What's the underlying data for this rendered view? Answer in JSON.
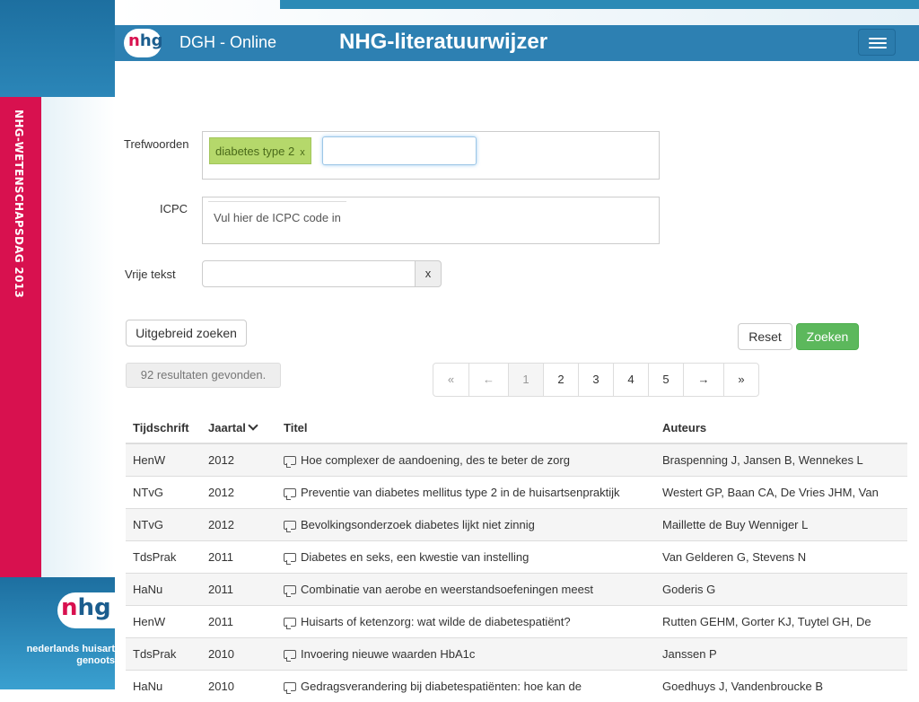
{
  "sidebar": {
    "vertical_text": "NHG-WETENSCHAPSDAG 2013",
    "caption_line1": "nederlands huisart",
    "caption_line2": "genoots",
    "logo_text": "nhg"
  },
  "navbar": {
    "logo_text": "nhg",
    "brand": "DGH - Online",
    "heading": "NHG-literatuurwijzer",
    "menu_icon": "hamburger-icon"
  },
  "form": {
    "trefwoorden_label": "Trefwoorden",
    "tag_label": "diabetes type 2",
    "tag_remove": "x",
    "tag_input_value": "",
    "icpc_label": "ICPC",
    "icpc_placeholder": "Vul hier de ICPC code in",
    "vrije_tekst_label": "Vrije tekst",
    "vrije_tekst_value": "",
    "clear_button": "x"
  },
  "buttons": {
    "advanced": "Uitgebreid zoeken",
    "reset": "Reset",
    "search": "Zoeken"
  },
  "results_count": "92 resultaten gevonden.",
  "pagination": [
    "«",
    "←",
    "1",
    "2",
    "3",
    "4",
    "5",
    "→",
    "»"
  ],
  "table": {
    "headers": [
      "Tijdschrift",
      "Jaartal",
      "Titel",
      "Auteurs"
    ],
    "rows": [
      [
        "HenW",
        "2012",
        "Hoe complexer de aandoening, des te beter de zorg",
        "Braspenning J, Jansen B, Wennekes L"
      ],
      [
        "NTvG",
        "2012",
        "Preventie van diabetes mellitus type 2 in de huisartsenpraktijk",
        "Westert GP, Baan CA, De Vries JHM, Van"
      ],
      [
        "NTvG",
        "2012",
        "Bevolkingsonderzoek diabetes lijkt niet zinnig",
        "Maillette de Buy Wenniger L"
      ],
      [
        "TdsPrak",
        "2011",
        "Diabetes en seks, een kwestie van instelling",
        "Van Gelderen G, Stevens N"
      ],
      [
        "HaNu",
        "2011",
        "Combinatie van aerobe en weerstandsoefeningen meest",
        "Goderis G"
      ],
      [
        "HenW",
        "2011",
        "Huisarts of ketenzorg: wat wilde de diabetespatiënt?",
        "Rutten GEHM, Gorter KJ, Tuytel GH, De"
      ],
      [
        "TdsPrak",
        "2010",
        "Invoering nieuwe waarden HbA1c",
        "Janssen P"
      ],
      [
        "HaNu",
        "2010",
        "Gedragsverandering bij diabetespatiënten: hoe kan de",
        "Goedhuys J, Vandenbroucke B"
      ]
    ]
  }
}
